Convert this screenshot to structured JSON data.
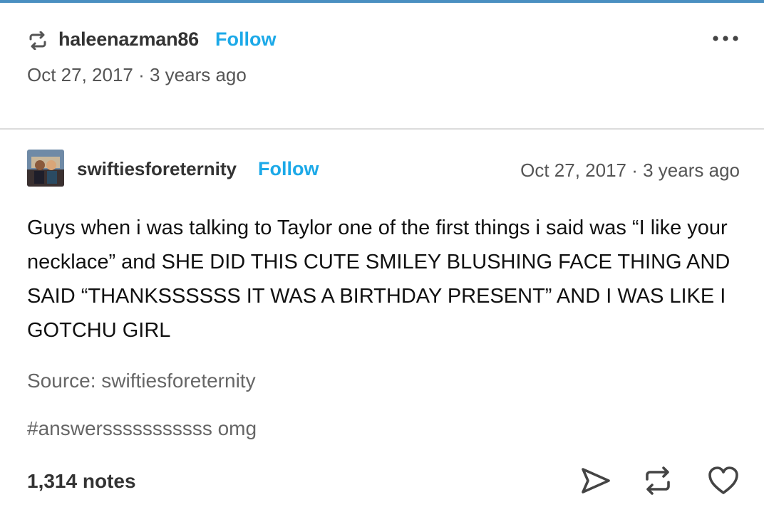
{
  "reblog": {
    "username": "haleenazman86",
    "follow_label": "Follow",
    "timestamp": "Oct 27, 2017 · 3 years ago",
    "icons": {
      "reblog": "reblog-icon",
      "more": "more-options-icon"
    }
  },
  "post": {
    "username": "swiftiesforeternity",
    "follow_label": "Follow",
    "timestamp": "Oct 27, 2017 · 3 years ago",
    "body": "Guys when i was talking to Taylor one of the first things i said was “I like your necklace” and SHE DID THIS CUTE SMILEY BLUSHING FACE THING AND SAID “THANKSSSSSS IT WAS A BIRTHDAY PRESENT” AND I WAS LIKE I GOTCHU GIRL",
    "source": "Source: swiftiesforeternity",
    "tags": "#answersssssssssss omg"
  },
  "footer": {
    "notes": "1,314 notes",
    "icons": [
      "share-icon",
      "reblog-icon",
      "like-heart-icon"
    ]
  },
  "colors": {
    "accent": "#1ca9e8",
    "top_bar": "#4a8fc1"
  }
}
